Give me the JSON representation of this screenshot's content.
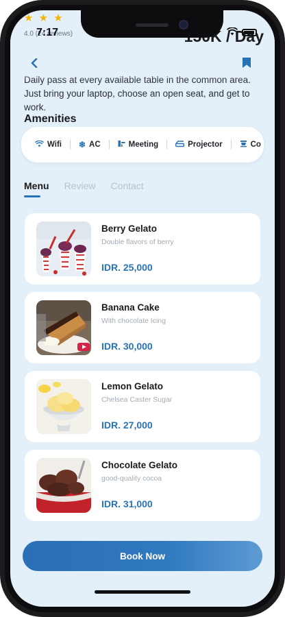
{
  "status": {
    "time": "7:17"
  },
  "peek": {
    "stars": "★ ★ ★",
    "rating": "4.0 (24 reviews)",
    "price": "150K / Day"
  },
  "description": "Daily pass at every available table in the common area. Just bring your laptop, choose an open seat, and get to work.",
  "amenities": {
    "title": "Amenities",
    "items": [
      {
        "label": "Wifi",
        "icon": "wifi-icon"
      },
      {
        "label": "AC",
        "icon": "snowflake-icon"
      },
      {
        "label": "Meeting",
        "icon": "meeting-icon"
      },
      {
        "label": "Projector",
        "icon": "projector-icon"
      },
      {
        "label": "Co",
        "icon": "coffee-icon"
      }
    ]
  },
  "tabs": [
    {
      "label": "Menu",
      "active": true
    },
    {
      "label": "Review",
      "active": false
    },
    {
      "label": "Contact",
      "active": false
    }
  ],
  "menu": [
    {
      "name": "Berry Gelato",
      "desc": "Double flavors of berry",
      "price": "IDR. 25,000",
      "image": "berry-gelato-image"
    },
    {
      "name": "Banana Cake",
      "desc": "With chocolate Icing",
      "price": "IDR. 30,000",
      "image": "banana-cake-image"
    },
    {
      "name": "Lemon Gelato",
      "desc": "Chelsea Caster Sugar",
      "price": "IDR. 27,000",
      "image": "lemon-gelato-image"
    },
    {
      "name": "Chocolate Gelato",
      "desc": "good-quality cocoa",
      "price": "IDR. 31,000",
      "image": "chocolate-gelato-image"
    }
  ],
  "book_button": "Book Now",
  "colors": {
    "accent": "#2872b6",
    "background": "#e3eff9",
    "star": "#f5b400"
  }
}
